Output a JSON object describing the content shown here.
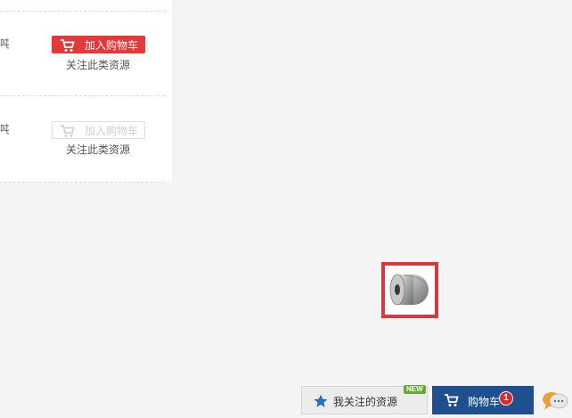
{
  "rows": [
    {
      "unit": "吨",
      "cart_label": "加入购物车",
      "follow_label": "关注此类资源",
      "state": "active"
    },
    {
      "unit": "吨",
      "cart_label": "加入购物车",
      "follow_label": "关注此类资源",
      "state": "disabled"
    }
  ],
  "product": {
    "icon": "steel-coil-icon"
  },
  "bottom_bar": {
    "watch_label": "我关注的资源",
    "new_badge": "NEW",
    "cart_label": "购物车",
    "cart_count": "1",
    "chat_icon": "chat-bubbles-icon"
  },
  "colors": {
    "accent": "#e23a3a",
    "cart_tab": "#1e4f8f",
    "new_badge": "#62ab2e"
  }
}
